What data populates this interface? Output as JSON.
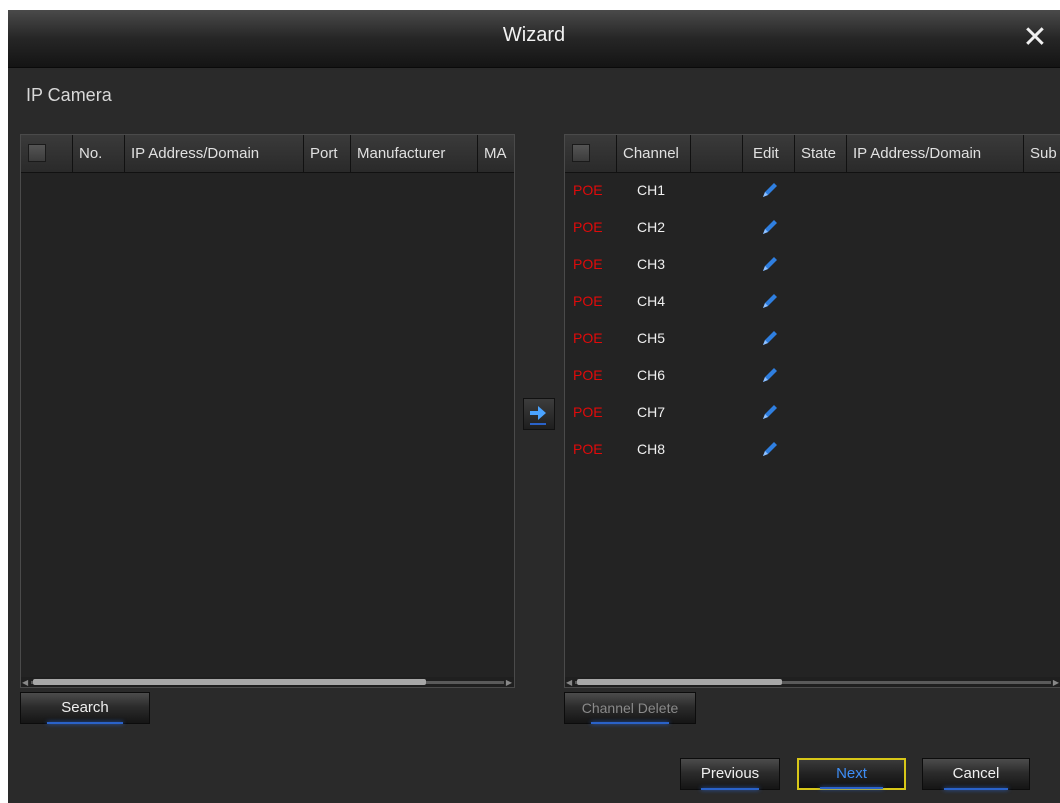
{
  "window": {
    "title": "Wizard"
  },
  "section": {
    "title": "IP Camera"
  },
  "left_table": {
    "headers": {
      "no": "No.",
      "ip": "IP Address/Domain",
      "port": "Port",
      "manufacturer": "Manufacturer",
      "mac": "MA"
    }
  },
  "right_table": {
    "headers": {
      "channel": "Channel",
      "blank": "",
      "edit": "Edit",
      "state": "State",
      "ip": "IP Address/Domain",
      "subnet": "Sub"
    },
    "rows": [
      {
        "type": "POE",
        "channel": "CH1"
      },
      {
        "type": "POE",
        "channel": "CH2"
      },
      {
        "type": "POE",
        "channel": "CH3"
      },
      {
        "type": "POE",
        "channel": "CH4"
      },
      {
        "type": "POE",
        "channel": "CH5"
      },
      {
        "type": "POE",
        "channel": "CH6"
      },
      {
        "type": "POE",
        "channel": "CH7"
      },
      {
        "type": "POE",
        "channel": "CH8"
      }
    ]
  },
  "buttons": {
    "search": "Search",
    "channel_delete": "Channel Delete",
    "previous": "Previous",
    "next": "Next",
    "cancel": "Cancel"
  },
  "icons": {
    "close": "close-icon",
    "move": "arrow-right-icon",
    "edit": "pencil-icon"
  },
  "colors": {
    "poe_text": "#e00a0a",
    "accent_blue": "#2a62c9",
    "next_border": "#d8c718"
  }
}
